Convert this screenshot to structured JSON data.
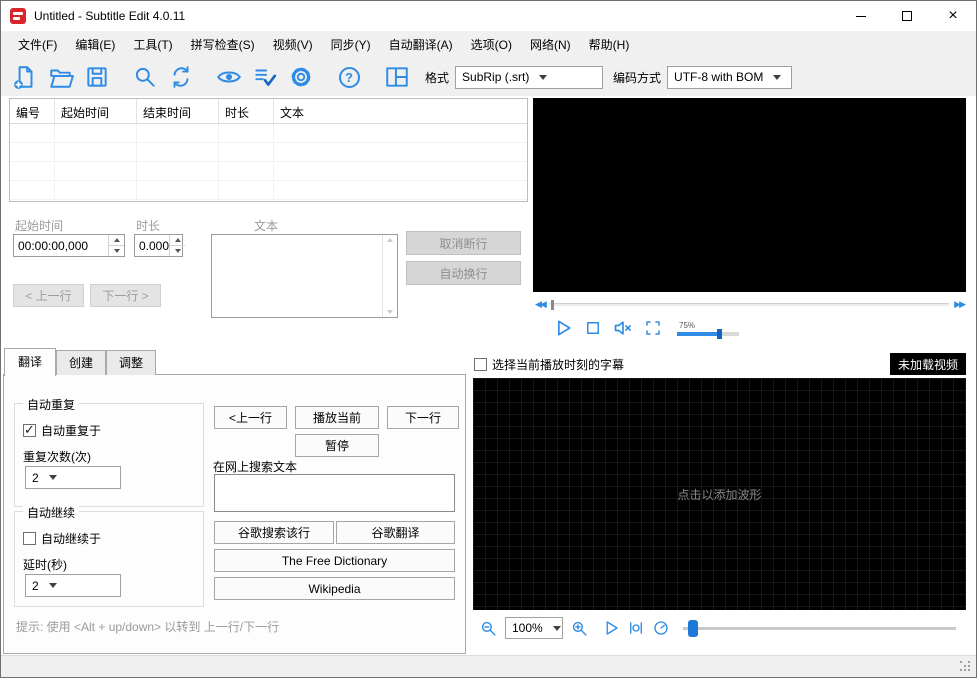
{
  "window": {
    "title": "Untitled - Subtitle Edit 4.0.11"
  },
  "menu": {
    "items": [
      "文件(F)",
      "编辑(E)",
      "工具(T)",
      "拼写检查(S)",
      "视频(V)",
      "同步(Y)",
      "自动翻译(A)",
      "选项(O)",
      "网络(N)",
      "帮助(H)"
    ]
  },
  "toolbar": {
    "format_label": "格式",
    "format_value": "SubRip (.srt)",
    "encoding_label": "编码方式",
    "encoding_value": "UTF-8 with BOM"
  },
  "icons": {
    "help_glyph": "?",
    "rewind_glyph": "◀◀",
    "forward_glyph": "▶▶"
  },
  "colors": {
    "accent": "#2e8be6"
  },
  "subtitle_list": {
    "columns": [
      "编号",
      "起始时间",
      "结束时间",
      "时长",
      "文本"
    ]
  },
  "edit_panel": {
    "start_time_label": "起始时间",
    "duration_label": "时长",
    "text_label": "文本",
    "start_time_value": "00:00:00,000",
    "duration_value": "0.000",
    "unbreak_button": "取消断行",
    "autobreak_button": "自动换行",
    "prev_button": "< 上一行",
    "next_button": "下一行 >"
  },
  "video": {
    "volume_percent": "75%"
  },
  "tabs": {
    "items": [
      "翻译",
      "创建",
      "调整"
    ]
  },
  "translate_tab": {
    "auto_repeat_title": "自动重复",
    "auto_repeat_checkbox": "自动重复于",
    "repeat_count_label": "重复次数(次)",
    "repeat_count_value": "2",
    "auto_continue_title": "自动继续",
    "auto_continue_checkbox": "自动继续于",
    "delay_label": "延时(秒)",
    "delay_value": "2",
    "prev_line_button": "<上一行",
    "play_current_button": "播放当前",
    "next_line_button": "下一行",
    "pause_button": "暂停",
    "search_label": "在网上搜索文本",
    "search_value": "",
    "google_search_button": "谷歌搜索该行",
    "google_translate_button": "谷歌翻译",
    "free_dictionary_button": "The Free Dictionary",
    "wikipedia_button": "Wikipedia",
    "hint": "提示: 使用 <Alt + up/down> 以转到 上一行/下一行"
  },
  "waveform": {
    "select_checkbox": "选择当前播放时刻的字幕",
    "no_video_label": "未加载视频",
    "placeholder": "点击以添加波形",
    "zoom_value": "100%"
  }
}
